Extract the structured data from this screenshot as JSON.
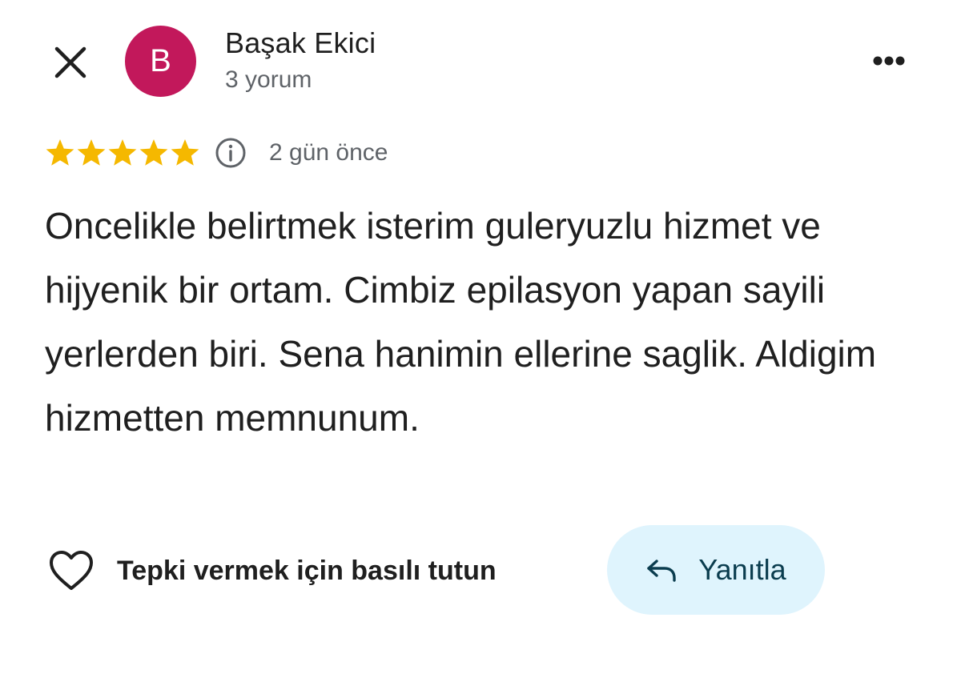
{
  "header": {
    "avatar_letter": "B",
    "author_name": "Başak Ekici",
    "author_meta": "3 yorum",
    "close_icon": "close-icon",
    "more_icon": "more-horizontal-icon"
  },
  "review": {
    "rating": 5,
    "rating_max": 5,
    "date": "2 gün önce",
    "info_icon": "info-icon",
    "text": "Oncelikle belirtmek isterim guleryuzlu hizmet ve hijyenik bir ortam. Cimbiz epilasyon yapan sayili yerlerden biri. Sena hanimin ellerine saglik. Aldigim hizmetten memnunum."
  },
  "actions": {
    "react_label": "Tepki vermek için basılı tutun",
    "reply_label": "Yanıtla",
    "heart_icon": "heart-icon",
    "reply_icon": "reply-arrow-icon"
  },
  "colors": {
    "avatar_bg": "#c2185b",
    "star": "#f5b800",
    "reply_bg": "#dff4fd",
    "secondary_text": "#5f6368"
  }
}
